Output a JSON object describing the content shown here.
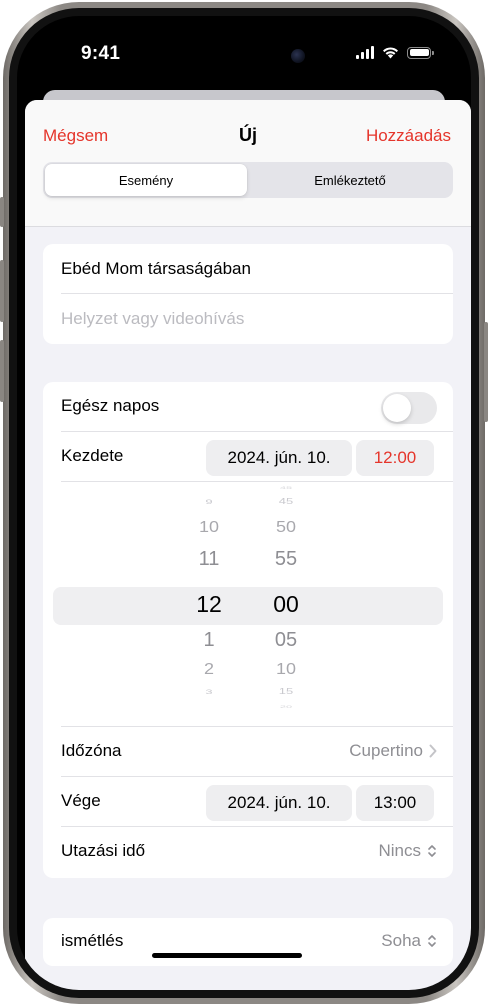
{
  "status_bar": {
    "time": "9:41"
  },
  "nav": {
    "cancel_label": "Mégsem",
    "title": "Új",
    "add_label": "Hozzáadás"
  },
  "segments": {
    "event_label": "Esemény",
    "reminder_label": "Emlékeztető",
    "selected": "event"
  },
  "details": {
    "title_value": "Ebéd Mom társaságában",
    "location_placeholder": "Helyzet vagy videohívás"
  },
  "timing": {
    "all_day_label": "Egész napos",
    "all_day_on": false,
    "start_label": "Kezdete",
    "start_date": "2024. jún. 10.",
    "start_time": "12:00",
    "hours": [
      "9",
      "10",
      "11",
      "12",
      "1",
      "2",
      "3"
    ],
    "minutes": [
      "45",
      "45",
      "50",
      "55",
      "00",
      "05",
      "10",
      "15",
      "20"
    ],
    "timezone_label": "Időzóna",
    "timezone_value": "Cupertino",
    "end_label": "Vége",
    "end_date": "2024. jún. 10.",
    "end_time": "13:00",
    "travel_label": "Utazási idő",
    "travel_value": "Nincs"
  },
  "repeat": {
    "label": "ismétlés",
    "value": "Soha"
  },
  "colors": {
    "accent": "#e5352b",
    "background": "#f2f2f7",
    "secondary_text": "#8e8e93"
  }
}
